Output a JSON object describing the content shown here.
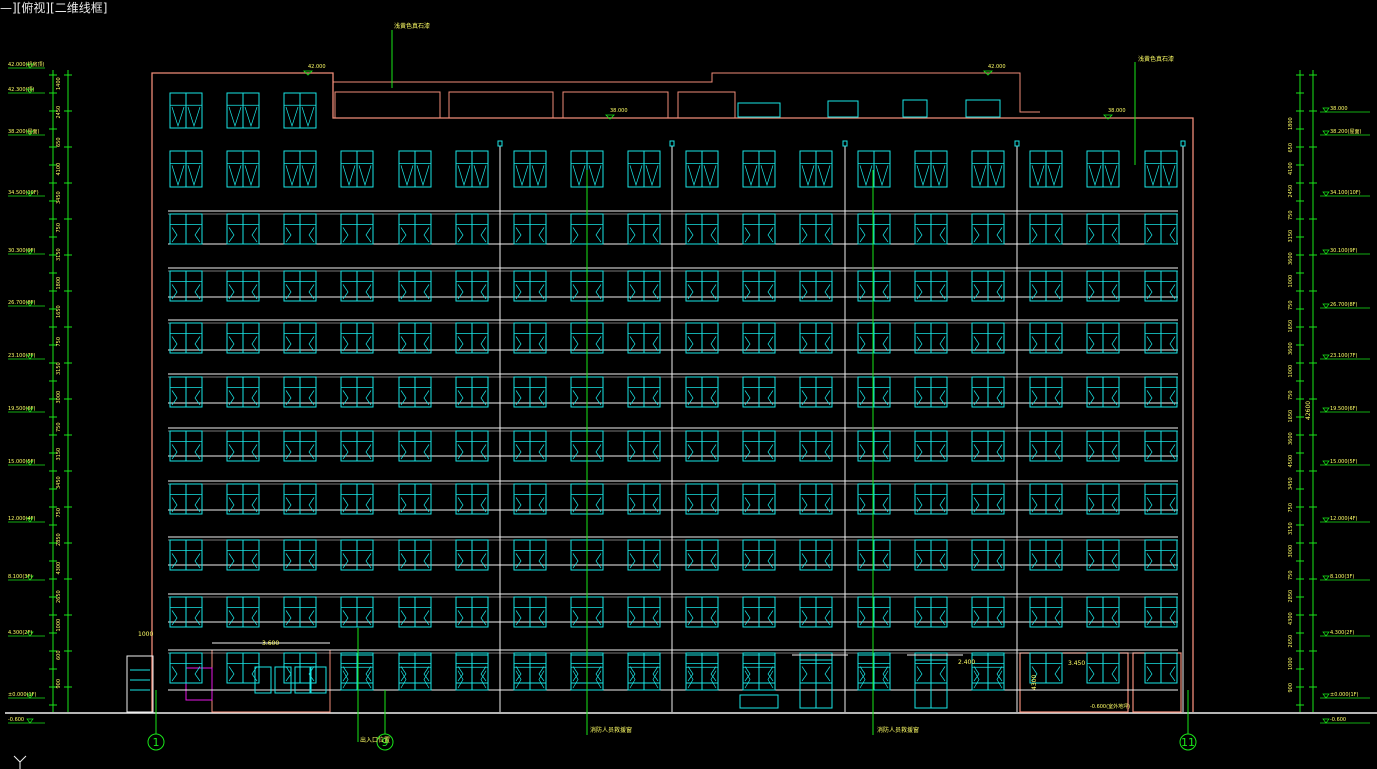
{
  "viewport": {
    "label": "—][俯视][二维线框]"
  },
  "colors": {
    "background": "#000000",
    "outline": "#f08c78",
    "window": "#19e6e6",
    "floor_line": "#f0f0f0",
    "dimension": "#19e619",
    "text": "#ffff66",
    "label": "#f0f0f0",
    "magenta": "#e619e6"
  },
  "elevation": {
    "roof_marks": [
      "42.000",
      "42.000",
      "38.000",
      "38.000"
    ],
    "left_levels": [
      "42.000(机房顶)",
      "42.300(顶)",
      "38.200(屋面)",
      "34.500(10F)",
      "30.300(9F)",
      "26.700(8F)",
      "23.100(7F)",
      "19.500(6F)",
      "15.000(5F)",
      "12.000(4F)",
      "8.100(3F)",
      "4.300(2F)",
      "±0.000(1F)",
      "-0.600"
    ],
    "right_levels": [
      "38.000",
      "38.200(屋面)",
      "34.100(10F)",
      "30.100(9F)",
      "26.700(8F)",
      "23.100(7F)",
      "19.500(6F)",
      "15.000(5F)",
      "12.000(4F)",
      "8.100(3F)",
      "4.300(2F)",
      "±0.000(1F)",
      "-0.600"
    ],
    "left_dims": [
      "1400",
      "2450",
      "650",
      "4100",
      "3450",
      "750",
      "3150",
      "1800",
      "1650",
      "750",
      "3150",
      "3000",
      "750",
      "3150",
      "3450",
      "750",
      "2850",
      "4300",
      "2650",
      "1000",
      "600",
      "900"
    ],
    "right_dims": [
      "1800",
      "650",
      "4100",
      "2450",
      "750",
      "3150",
      "3600",
      "1000",
      "750",
      "1650",
      "3600",
      "1000",
      "750",
      "1650",
      "3600",
      "4500",
      "3450",
      "750",
      "3150",
      "3000",
      "750",
      "2850",
      "4300",
      "2650",
      "1000",
      "900"
    ],
    "right_total": "42600"
  },
  "annotations": {
    "top_material_1": "浅黄色真石漆",
    "top_material_2": "浅黄色真石漆",
    "rescue_window_1": "消防人员救援窗",
    "rescue_window_2": "消防人员救援窗",
    "entrance_note": "出入口位置",
    "canopy_width": "3.600",
    "canopy_height": "1000",
    "door_dim_1": "2.400",
    "garage_dim": "3.450",
    "garage_height": "4300",
    "ground_mark": "-0.600(室外地坪)"
  },
  "axis_markers": [
    "1",
    "9",
    "11"
  ]
}
